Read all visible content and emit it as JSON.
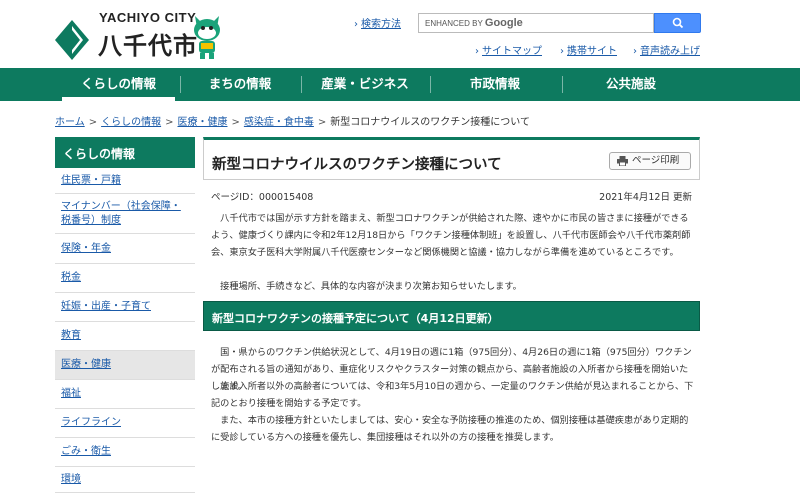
{
  "header": {
    "logo_en": "YACHIYO CITY",
    "logo_ja": "八千代市",
    "search_label": "検索方法",
    "search_placeholder_prefix": "ENHANCED BY",
    "search_placeholder_brand": "Google",
    "links": [
      "サイトマップ",
      "携帯サイト",
      "音声読み上げ"
    ]
  },
  "gnav": [
    "くらしの情報",
    "まちの情報",
    "産業・ビジネス",
    "市政情報",
    "公共施設"
  ],
  "breadcrumb": [
    "ホーム",
    "くらしの情報",
    "医療・健康",
    "感染症・食中毒",
    "新型コロナウイルスのワクチン接種について"
  ],
  "sidebar": {
    "heading": "くらしの情報",
    "items": [
      "住民票・戸籍",
      "マイナンバー（社会保障・税番号）制度",
      "保険・年金",
      "税金",
      "妊娠・出産・子育て",
      "教育",
      "医療・健康",
      "福祉",
      "ライフライン",
      "ごみ・衛生",
      "環境"
    ]
  },
  "main": {
    "title": "新型コロナウイルスのワクチン接種について",
    "print_label": "ページ印刷",
    "page_id": "ページID：000015408",
    "updated": "2021年4月12日 更新",
    "para1": "八千代市では国が示す方針を踏まえ、新型コロナワクチンが供給された際、速やかに市民の皆さまに接種ができるよう、健康づくり課内に令和2年12月18日から「ワクチン接種体制班」を設置し、八千代市医師会や八千代市薬剤師会、東京女子医科大学附属八千代医療センターなど関係機関と協議・協力しながら準備を進めているところです。",
    "para2": "接種場所、手続きなど、具体的な内容が決まり次第お知らせいたします。",
    "section_heading": "新型コロナワクチンの接種予定について（4月12日更新）",
    "para3": "国・県からのワクチン供給状況として、4月19日の週に1箱（975回分）、4月26日の週に1箱（975回分）ワクチンが配布される旨の通知があり、重症化リスクやクラスター対策の観点から、高齢者施設の入所者から接種を開始いたします。",
    "para4": "施設入所者以外の高齢者については、令和3年5月10日の週から、一定量のワクチン供給が見込まれることから、下記のとおり接種を開始する予定です。",
    "para5": "また、本市の接種方針といたしましては、安心・安全な予防接種の推進のため、個別接種は基礎疾患があり定期的に受診している方への接種を優先し、集団接種はそれ以外の方の接種を推奨します。"
  }
}
